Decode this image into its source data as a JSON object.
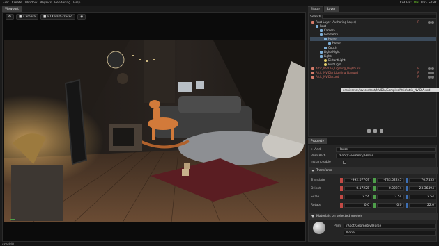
{
  "menubar": {
    "items": [
      "Edit",
      "Create",
      "Window",
      "Physics",
      "Rendering",
      "Help"
    ],
    "cache_label": "CACHE:",
    "cache_state": "ON",
    "live_sync": "LIVE SYNC"
  },
  "viewport": {
    "tab": "Viewport",
    "camera_label": "Camera",
    "render_label": "RTX Path-traced"
  },
  "stage": {
    "tabs": [
      "Stage",
      "Layer"
    ],
    "search_label": "Search",
    "rows": [
      {
        "label": "Root Layer (Authoring Layer)",
        "indent": 0,
        "sel": false,
        "badge": "R",
        "icon": "layer"
      },
      {
        "label": "Root",
        "indent": 1,
        "sel": false,
        "badge": "",
        "icon": "prim"
      },
      {
        "label": "Camera",
        "indent": 2,
        "sel": false,
        "badge": "",
        "icon": "prim"
      },
      {
        "label": "Geometry",
        "indent": 2,
        "sel": false,
        "badge": "",
        "icon": "prim"
      },
      {
        "label": "Horse",
        "indent": 3,
        "sel": true,
        "badge": "",
        "icon": "prim"
      },
      {
        "label": "Horse",
        "indent": 4,
        "sel": false,
        "badge": "",
        "icon": "prim"
      },
      {
        "label": "Couch",
        "indent": 3,
        "sel": false,
        "badge": "",
        "icon": "prim"
      },
      {
        "label": "LightsNight",
        "indent": 2,
        "sel": false,
        "badge": "",
        "icon": "prim"
      },
      {
        "label": "Lights",
        "indent": 2,
        "sel": false,
        "badge": "",
        "icon": "prim"
      },
      {
        "label": "DistantLight",
        "indent": 3,
        "sel": false,
        "badge": "",
        "icon": "light"
      },
      {
        "label": "BulbLight",
        "indent": 3,
        "sel": false,
        "badge": "",
        "icon": "light"
      },
      {
        "label": "Attic_NVIDIA_Lighting_Night.usd",
        "indent": 0,
        "sel": false,
        "badge": "R",
        "icon": "layer"
      },
      {
        "label": "Attic_NVIDIA_Lighting_Day.usd",
        "indent": 0,
        "sel": false,
        "badge": "R",
        "icon": "layer"
      },
      {
        "label": "Attic_NVIDIA.usd",
        "indent": 0,
        "sel": false,
        "badge": "R",
        "icon": "layer"
      }
    ],
    "tooltip": "omniverse://ov-content/NVIDIA/Samples/Attic/Attic_NVIDIA.usd"
  },
  "property": {
    "tab": "Property",
    "add_label": "Add",
    "name_value": "Horse",
    "prim_path_label": "Prim Path",
    "prim_path": "/Root/Geometry/Horse",
    "instanceable_label": "Instanceable",
    "transform_title": "Transform",
    "rows": [
      {
        "label": "Translate",
        "x": "-992.07709",
        "y": "-733.52245",
        "z": "70.7555"
      },
      {
        "label": "Orient",
        "x": "-0.17225",
        "y": "-0.02274",
        "z": "23.36494"
      },
      {
        "label": "Scale",
        "x": "2.54",
        "y": "2.54",
        "z": "2.54"
      },
      {
        "label": "Rotate",
        "x": "0.0",
        "y": "0.0",
        "z": "22.0"
      }
    ],
    "materials_title": "Materials on selected models",
    "material_prim_label": "Prim",
    "material_prim": "/Root/Geometry/Horse",
    "material_value": "None"
  },
  "status": "ay orbit)"
}
